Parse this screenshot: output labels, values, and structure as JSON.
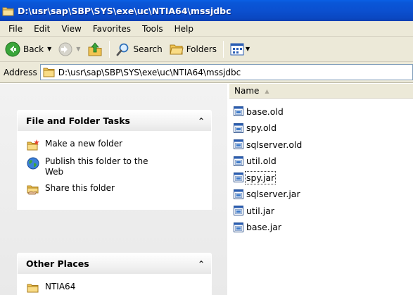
{
  "window": {
    "title": "D:\\usr\\sap\\SBP\\SYS\\exe\\uc\\NTIA64\\mssjdbc"
  },
  "menubar": {
    "items": [
      "File",
      "Edit",
      "View",
      "Favorites",
      "Tools",
      "Help"
    ]
  },
  "toolbar": {
    "back_label": "Back",
    "search_label": "Search",
    "folders_label": "Folders"
  },
  "address": {
    "label": "Address",
    "value": "D:\\usr\\sap\\SBP\\SYS\\exe\\uc\\NTIA64\\mssjdbc"
  },
  "taskpane": {
    "file_tasks": {
      "title": "File and Folder Tasks",
      "items": [
        "Make a new folder",
        "Publish this folder to the Web",
        "Share this folder"
      ]
    },
    "other_places": {
      "title": "Other Places",
      "items": [
        "NTIA64"
      ]
    }
  },
  "filelist": {
    "column_name": "Name",
    "sort": "ascending",
    "files": [
      "base.old",
      "spy.old",
      "sqlserver.old",
      "util.old",
      "spy.jar",
      "sqlserver.jar",
      "util.jar",
      "base.jar"
    ],
    "focused_file": "spy.jar"
  },
  "colors": {
    "titlebar": "#0b50d0",
    "chrome": "#ece9d8",
    "taskpane_bg": "#eeeeee"
  }
}
